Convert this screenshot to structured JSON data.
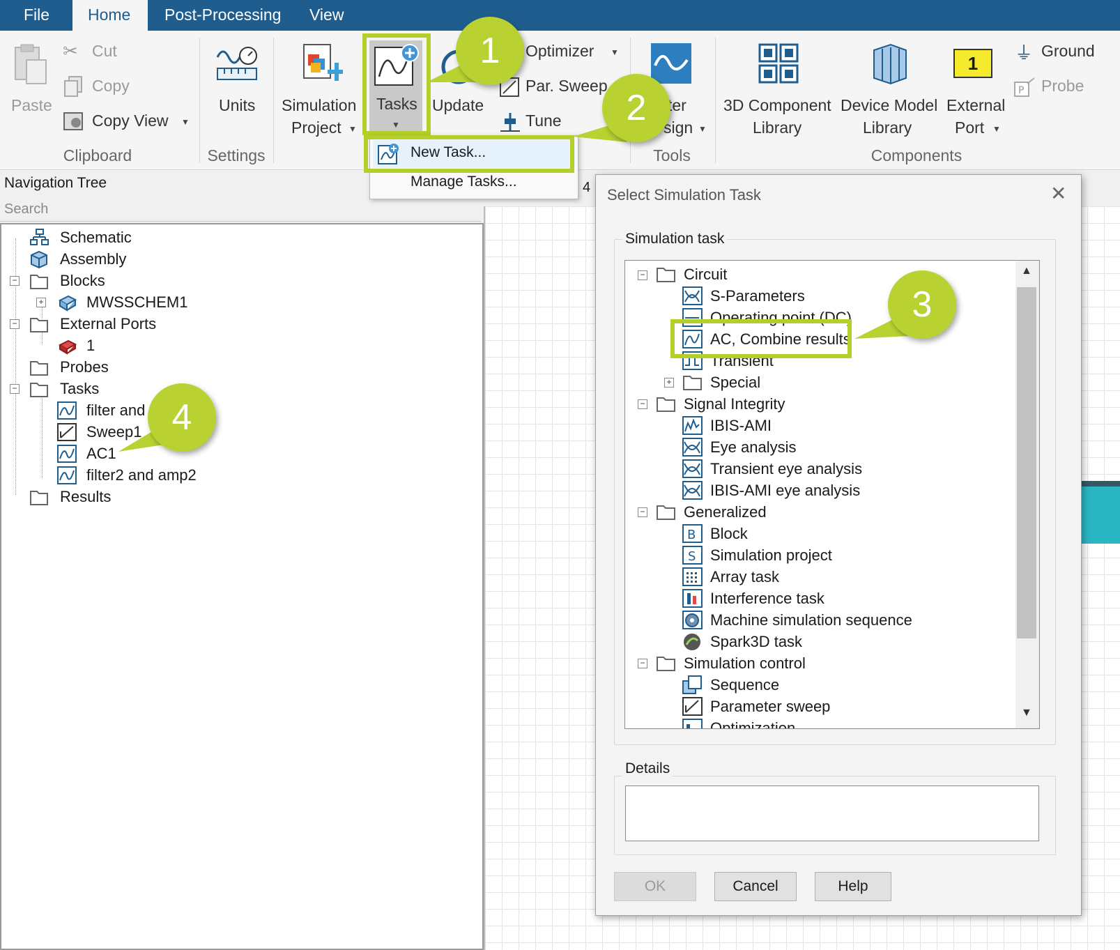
{
  "tabs": [
    {
      "label": "File",
      "active": false
    },
    {
      "label": "Home",
      "active": true
    },
    {
      "label": "Post-Processing",
      "active": false
    },
    {
      "label": "View",
      "active": false
    }
  ],
  "ribbon": {
    "clipboard": {
      "paste": "Paste",
      "cut": "Cut",
      "copy": "Copy",
      "copy_view": "Copy View",
      "group": "Clipboard"
    },
    "settings": {
      "units": "Units",
      "group": "Settings"
    },
    "simulation_project": {
      "line1": "Simulation",
      "line2": "Project"
    },
    "tasks": "Tasks",
    "update": "Update",
    "optimizer": "Optimizer",
    "par_sweep": "Par. Sweep",
    "tune": "Tune",
    "filter_design": {
      "line1": "ter",
      "line2": "sign"
    },
    "tools_group": "Tools",
    "component_lib": {
      "line1": "3D Component",
      "line2": "Library"
    },
    "device_lib": {
      "line1": "Device Model",
      "line2": "Library"
    },
    "external_port": {
      "line1": "External",
      "line2": "Port",
      "badge": "1"
    },
    "ground": "Ground",
    "probe": "Probe",
    "components_group": "Components"
  },
  "tasks_menu": {
    "new_task": "New Task...",
    "manage_tasks": "Manage Tasks..."
  },
  "nav": {
    "title": "Navigation Tree",
    "search_placeholder": "Search",
    "items": [
      {
        "label": "Schematic"
      },
      {
        "label": "Assembly"
      },
      {
        "label": "Blocks"
      },
      {
        "label": "MWSSCHEM1"
      },
      {
        "label": "External Ports"
      },
      {
        "label": "1"
      },
      {
        "label": "Probes"
      },
      {
        "label": "Tasks"
      },
      {
        "label": "filter and ar"
      },
      {
        "label": "Sweep1"
      },
      {
        "label": "AC1"
      },
      {
        "label": "filter2 and amp2"
      },
      {
        "label": "Results"
      }
    ]
  },
  "canvas_fragment": "4",
  "dialog": {
    "title": "Select Simulation Task",
    "group_task": "Simulation task",
    "group_details": "Details",
    "ok": "OK",
    "cancel": "Cancel",
    "help": "Help",
    "list": [
      {
        "label": "Circuit",
        "icon": "folder-icon"
      },
      {
        "label": "S-Parameters",
        "icon": "sparam-icon"
      },
      {
        "label": "Operating point (DC)",
        "icon": "dc-icon"
      },
      {
        "label": "AC, Combine results",
        "icon": "ac-icon"
      },
      {
        "label": "Transient",
        "icon": "transient-icon"
      },
      {
        "label": "Special",
        "icon": "folder-icon"
      },
      {
        "label": "Signal Integrity",
        "icon": "folder-icon"
      },
      {
        "label": "IBIS-AMI",
        "icon": "ibis-icon"
      },
      {
        "label": "Eye analysis",
        "icon": "eye-icon"
      },
      {
        "label": "Transient eye analysis",
        "icon": "eye-icon"
      },
      {
        "label": "IBIS-AMI eye analysis",
        "icon": "eye-icon"
      },
      {
        "label": "Generalized",
        "icon": "folder-icon"
      },
      {
        "label": "Block",
        "icon": "block-icon"
      },
      {
        "label": "Simulation project",
        "icon": "simproject-icon"
      },
      {
        "label": "Array task",
        "icon": "array-icon"
      },
      {
        "label": "Interference task",
        "icon": "interference-icon"
      },
      {
        "label": "Machine simulation sequence",
        "icon": "machine-icon"
      },
      {
        "label": "Spark3D task",
        "icon": "spark3d-icon"
      },
      {
        "label": "Simulation control",
        "icon": "folder-icon"
      },
      {
        "label": "Sequence",
        "icon": "sequence-icon"
      },
      {
        "label": "Parameter sweep",
        "icon": "sweep-icon"
      },
      {
        "label": "Optimization",
        "icon": "optimization-icon"
      }
    ]
  },
  "callouts": [
    "1",
    "2",
    "3",
    "4"
  ],
  "colors": {
    "tabbar": "#1f5d8e",
    "highlight": "#b5cf2a",
    "callout": "#b9d232"
  }
}
